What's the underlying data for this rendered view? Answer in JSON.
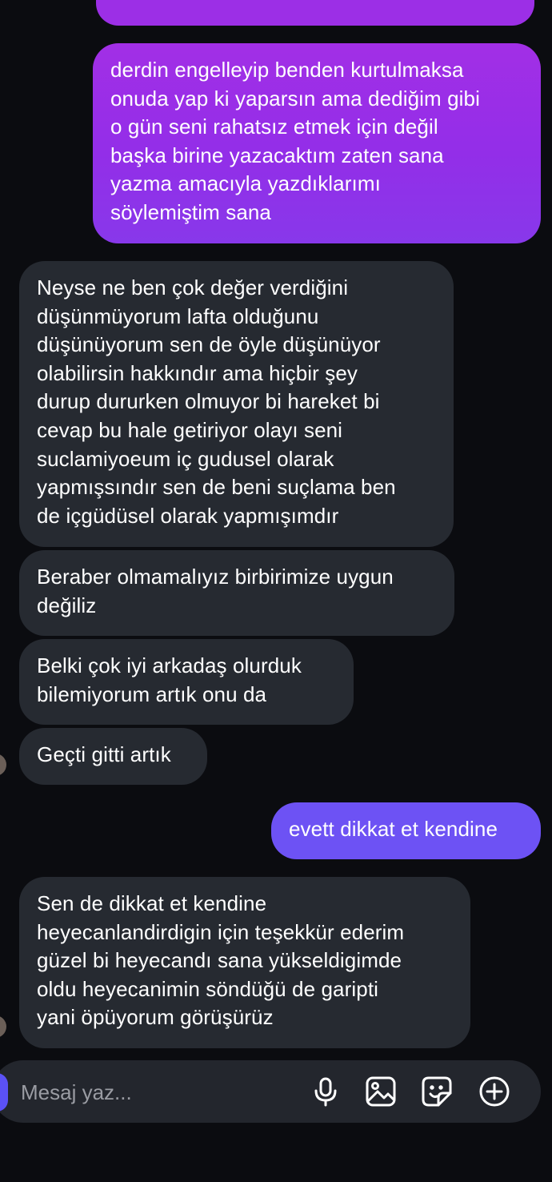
{
  "conversation": {
    "messages": [
      {
        "direction": "outgoing",
        "text": "derdin engelleyip benden kurtulmaksa\nonuda yap ki yaparsın ama dediğim gibi\no gün seni rahatsız etmek için değil\nbaşka birine yazacaktım zaten sana\nyazma amacıyla yazdıklarımı\nsöylemiştim sana"
      },
      {
        "direction": "incoming",
        "text": "Neyse ne ben çok değer verdiğini\ndüşünmüyorum lafta olduğunu\ndüşünüyorum sen de öyle düşünüyor\nolabilirsin hakkındır ama hiçbir şey\ndurup dururken olmuyor bi hareket bi\ncevap bu hale getiriyor olayı seni\nsuclamiyoeum iç gudusel olarak\nyapmışsındır sen de beni suçlama ben\nde içgüdüsel olarak yapmışımdır"
      },
      {
        "direction": "incoming",
        "text": "Beraber olmamalıyız birbirimize uygun\ndeğiliz"
      },
      {
        "direction": "incoming",
        "text": "Belki çok iyi arkadaş olurduk\nbilemiyorum artık onu da"
      },
      {
        "direction": "incoming",
        "text": "Geçti gitti artık"
      },
      {
        "direction": "outgoing",
        "text": "evett dikkat et kendine"
      },
      {
        "direction": "incoming",
        "text": "Sen de dikkat et kendine\nheyecanlandirdigin için teşekkür ederim\ngüzel bi heyecandı sana yükseldigimde\noldu heyecanimin söndüğü de garipti\nyani öpüyorum görüşürüz"
      }
    ]
  },
  "composer": {
    "placeholder": "Mesaj yaz...",
    "icons": [
      "microphone-icon",
      "gallery-icon",
      "sticker-icon",
      "plus-icon"
    ]
  },
  "colors": {
    "background": "#0b0c10",
    "incoming_bubble": "#262a31",
    "outgoing_gradient_top": "#a22fe6",
    "outgoing_gradient_bottom": "#8838ea",
    "outgoing_solid": "#6d52f4",
    "composer": "#23262d",
    "placeholder_text": "#9a9ca3"
  }
}
